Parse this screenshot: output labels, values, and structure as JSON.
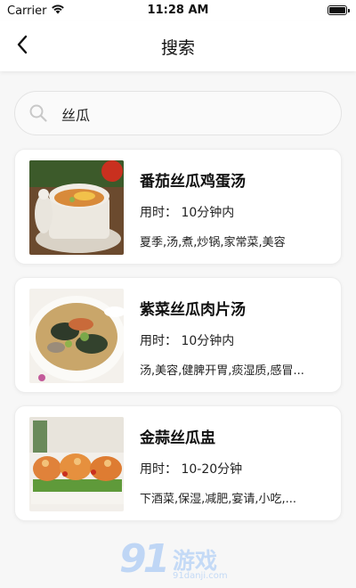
{
  "status_bar": {
    "carrier": "Carrier",
    "time": "11:28 AM",
    "icons": [
      "wifi-icon",
      "battery-icon"
    ]
  },
  "nav": {
    "title": "搜索",
    "back_icon": "chevron-left-icon"
  },
  "search": {
    "icon": "search-icon",
    "value": "丝瓜"
  },
  "results": [
    {
      "title": "番茄丝瓜鸡蛋汤",
      "time": "用时：  10分钟内",
      "tags": "夏季,汤,煮,炒锅,家常菜,美容"
    },
    {
      "title": "紫菜丝瓜肉片汤",
      "time": "用时：  10分钟内",
      "tags": "汤,美容,健脾开胃,痰湿质,感冒..."
    },
    {
      "title": "金蒜丝瓜盅",
      "time": "用时：  10-20分钟",
      "tags": "下酒菜,保湿,减肥,宴请,小吃,..."
    }
  ],
  "watermark": {
    "number": "91",
    "text": "游戏",
    "sub": "91danji.com"
  }
}
